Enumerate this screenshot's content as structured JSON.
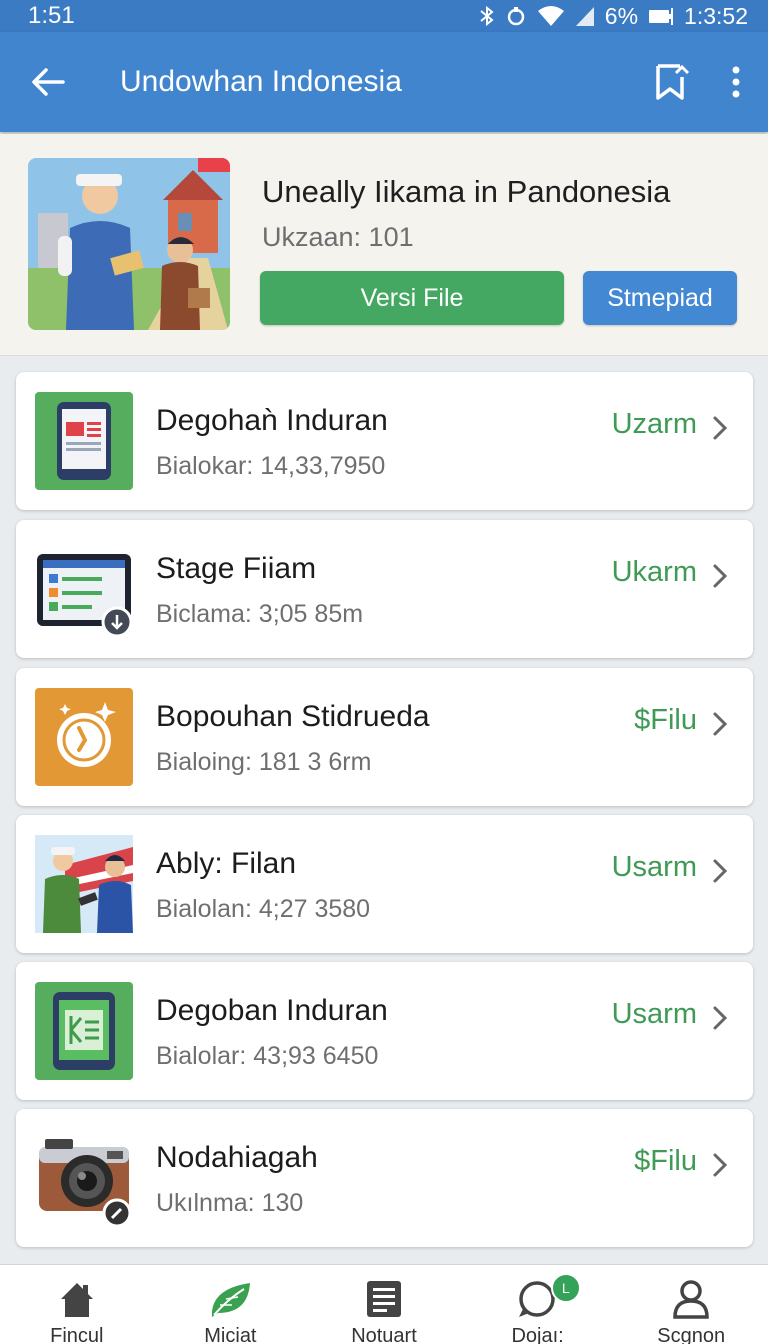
{
  "status_bar": {
    "time_left": "1:51",
    "battery": "6%",
    "time_right": "1:3:52"
  },
  "app_bar": {
    "title": "Undowhan Indonesia",
    "back_icon": "arrow-left-icon",
    "bookmark_icon": "bookmark-icon",
    "more_icon": "more-vert-icon"
  },
  "hero": {
    "title": "Uneally Iikama in Pandonesia",
    "subtitle": "Ukzaan: 101",
    "primary_button": "Versi File",
    "secondary_button": "Stmepiad"
  },
  "items": [
    {
      "name": "Degohaǹ Induran",
      "meta": "Bialokar: 14,33,7950",
      "status": "Uzarm",
      "icon": "tablet-document-icon"
    },
    {
      "name": "Stage Fiiam",
      "meta": "Biclama:  3;05 85m",
      "status": "Ukarm",
      "icon": "checklist-tablet-icon"
    },
    {
      "name": "Bopouhan Stidrueda",
      "meta": "Bialoing: 181 3 6rm",
      "status": "$Filu",
      "icon": "clock-badge-icon"
    },
    {
      "name": "Ably: Filan",
      "meta": "Bialolan: 4;27 3580",
      "status": "Usarm",
      "icon": "officers-icon"
    },
    {
      "name": "Degoban Induran",
      "meta": "Bialolar: 43;93 6450",
      "status": "Usarm",
      "icon": "tablet-list-icon"
    },
    {
      "name": "Nodahiagah",
      "meta": "Ukılnma: 130",
      "status": "$Filu",
      "icon": "camera-icon"
    }
  ],
  "bottom_nav": [
    {
      "label": "Fincul",
      "icon": "home-icon"
    },
    {
      "label": "Miciat",
      "icon": "leaf-icon"
    },
    {
      "label": "Notuart",
      "icon": "document-icon"
    },
    {
      "label": "Dojaı:",
      "icon": "chat-icon",
      "badge": "L"
    },
    {
      "label": "Scgnon",
      "icon": "person-icon"
    }
  ],
  "colors": {
    "appbar": "#4285cf",
    "status_green": "#3f9a56",
    "button_green": "#44a863",
    "button_blue": "#4288d2"
  }
}
